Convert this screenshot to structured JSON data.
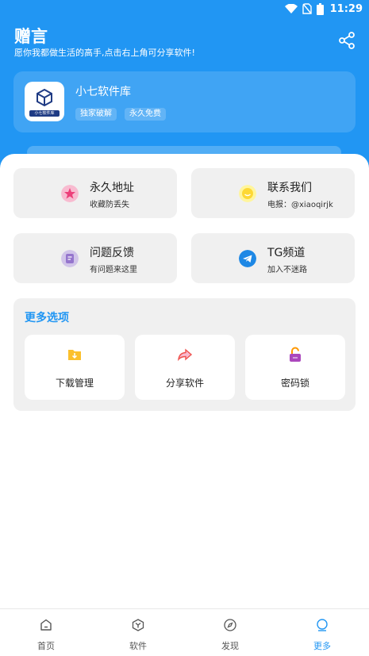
{
  "status_bar": {
    "time": "11:29"
  },
  "header": {
    "title": "赠言",
    "subtitle": "愿你我都做生活的高手,点击右上角可分享软件!"
  },
  "app_card": {
    "name": "小七软件库",
    "logo_text": "小七软件库",
    "tags": [
      "独家破解",
      "永久免费"
    ]
  },
  "tiles": [
    {
      "title": "永久地址",
      "subtitle": "收藏防丢失",
      "icon": "star-icon",
      "color": "#f06292"
    },
    {
      "title": "联系我们",
      "subtitle": "电报：@xiaoqirjk",
      "icon": "smile-icon",
      "color": "#fdd835"
    },
    {
      "title": "问题反馈",
      "subtitle": "有问题来这里",
      "icon": "feedback-icon",
      "color": "#9575cd"
    },
    {
      "title": "TG频道",
      "subtitle": "加入不迷路",
      "icon": "telegram-icon",
      "color": "#1e88e5"
    }
  ],
  "more_options": {
    "title": "更多选项",
    "items": [
      {
        "label": "下载管理",
        "icon": "download-folder-icon",
        "color": "#fbc02d"
      },
      {
        "label": "分享软件",
        "icon": "share-arrow-icon",
        "color": "#ef5350"
      },
      {
        "label": "密码锁",
        "icon": "unlock-icon",
        "color": "#ab47bc"
      }
    ]
  },
  "tabbar": {
    "items": [
      {
        "label": "首页",
        "icon": "home-icon"
      },
      {
        "label": "软件",
        "icon": "box-icon"
      },
      {
        "label": "发现",
        "icon": "compass-icon"
      },
      {
        "label": "更多",
        "icon": "more-icon"
      }
    ],
    "active": "更多"
  },
  "colors": {
    "primary": "#2196f3",
    "card_bg": "#f0f0f0"
  }
}
